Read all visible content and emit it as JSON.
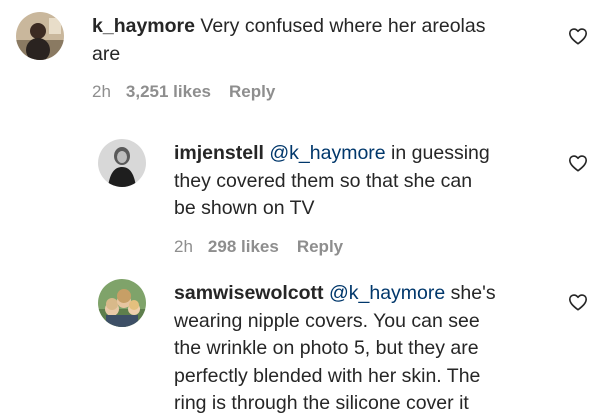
{
  "comments": [
    {
      "username": "k_haymore",
      "line1": " Very confused where her areolas",
      "line2": "are",
      "time": "2h",
      "likes": "3,251 likes",
      "reply": "Reply"
    },
    {
      "username": "imjenstell",
      "mention": "@k_haymore",
      "line1": " in guessing",
      "line2": "they covered them so that she can",
      "line3": "be shown on TV",
      "time": "2h",
      "likes": "298 likes",
      "reply": "Reply"
    },
    {
      "username": "samwisewolcott",
      "mention": "@k_haymore",
      "line1": " she's",
      "line2": "wearing nipple covers. You can see",
      "line3": "the wrinkle on photo 5, but they are",
      "line4": "perfectly blended with her skin. The",
      "line5": "ring is through the silicone cover it"
    }
  ],
  "icons": {
    "like": "heart-outline-icon"
  },
  "colors": {
    "text": "#262626",
    "secondary": "#8e8e8e",
    "mention": "#00376b"
  }
}
